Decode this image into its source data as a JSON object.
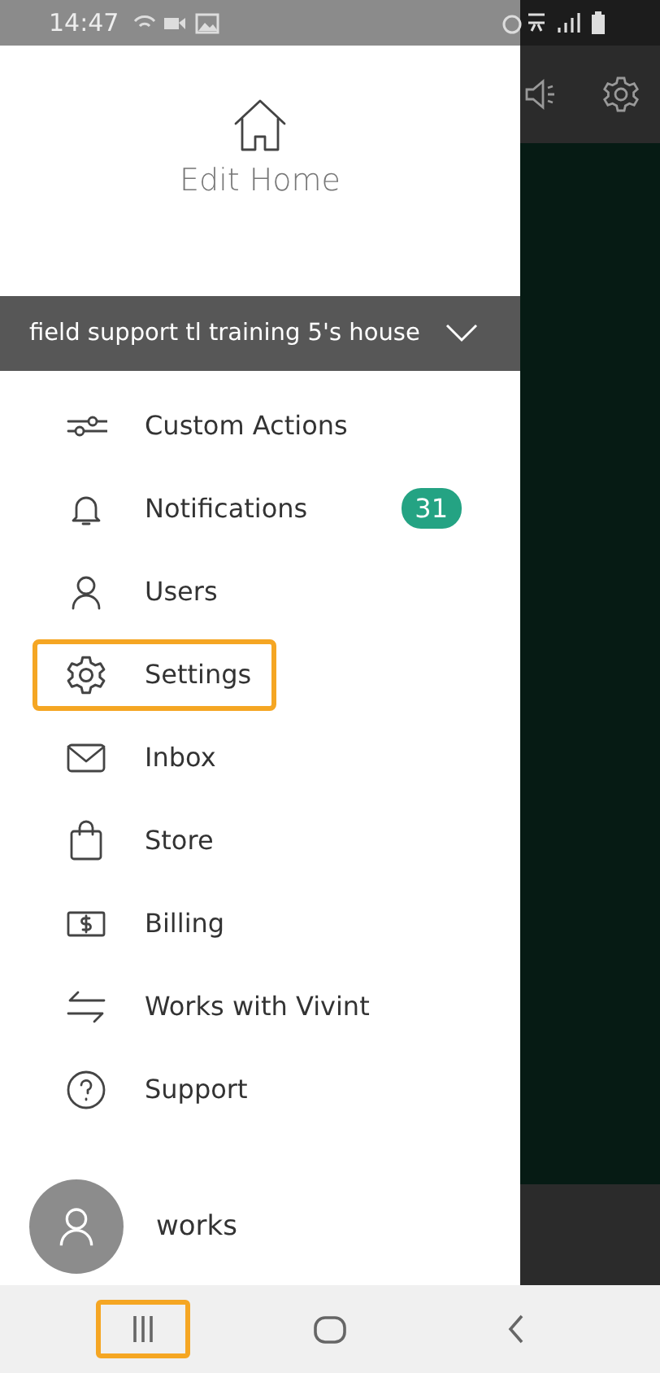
{
  "status_bar": {
    "time": "14:47"
  },
  "drawer": {
    "edit_home": {
      "label": "Edit Home"
    },
    "home_selector": {
      "label": "field support tl training 5's house"
    },
    "menu": [
      {
        "kind": "sliders",
        "label": "Custom Actions",
        "highlighted": false
      },
      {
        "kind": "bell",
        "label": "Notifications",
        "badge": "31",
        "highlighted": false
      },
      {
        "kind": "user",
        "label": "Users",
        "highlighted": false
      },
      {
        "kind": "gear",
        "label": "Settings",
        "highlighted": true
      },
      {
        "kind": "envelope",
        "label": "Inbox",
        "highlighted": false
      },
      {
        "kind": "bag",
        "label": "Store",
        "highlighted": false
      },
      {
        "kind": "bill",
        "label": "Billing",
        "highlighted": false
      },
      {
        "kind": "arrows",
        "label": "Works with Vivint",
        "highlighted": false
      },
      {
        "kind": "help",
        "label": "Support",
        "highlighted": false
      }
    ],
    "account": {
      "name": "works"
    }
  },
  "nav_bar": {
    "buttons": [
      {
        "kind": "recents",
        "highlighted": true
      },
      {
        "kind": "home",
        "highlighted": false
      },
      {
        "kind": "back",
        "highlighted": false
      }
    ]
  }
}
